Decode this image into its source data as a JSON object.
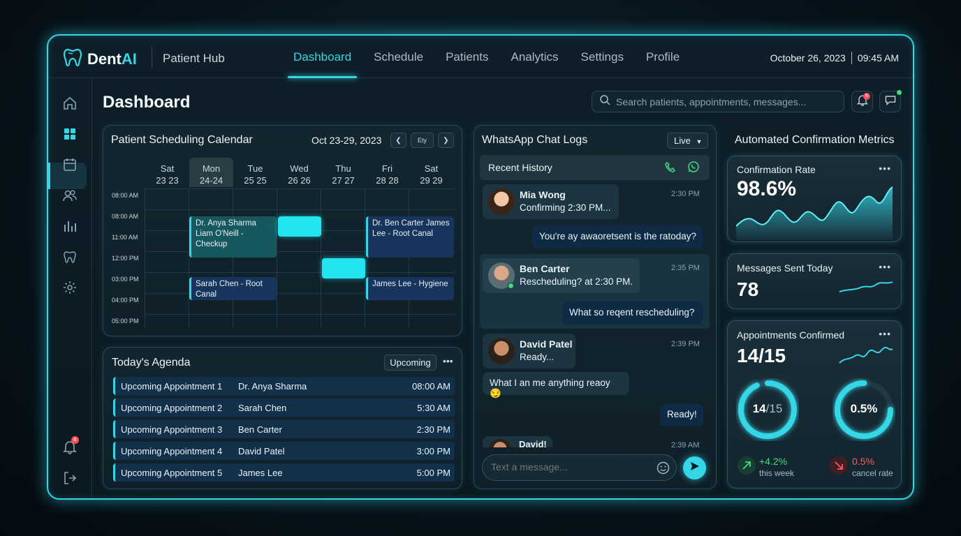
{
  "app": {
    "brand_prefix": "Dent",
    "brand_suffix": "AI",
    "section": "Patient Hub"
  },
  "nav": {
    "tabs": [
      {
        "label": "Dashboard",
        "active": true
      },
      {
        "label": "Schedule"
      },
      {
        "label": "Patients"
      },
      {
        "label": "Analytics"
      },
      {
        "label": "Settings"
      },
      {
        "label": "Profile"
      }
    ]
  },
  "header": {
    "date": "October 26, 2023",
    "time": "09:45 AM"
  },
  "sidebar": {
    "icons": [
      "home-icon",
      "dashboard-icon",
      "calendar-icon",
      "users-icon",
      "chart-icon",
      "tooth-icon",
      "gear-icon",
      "bell-icon",
      "logout-icon"
    ],
    "bell_badge": "6"
  },
  "main": {
    "title": "Dashboard",
    "search_placeholder": "Search patients, appointments, messages...",
    "notif_badge": "6"
  },
  "calendar": {
    "title": "Patient Scheduling Calendar",
    "range": "Oct 23-29, 2023",
    "nav_btn": "Ety",
    "days": [
      {
        "name": "Sat",
        "date": "23 23"
      },
      {
        "name": "Mon",
        "date": "24-24"
      },
      {
        "name": "Tue",
        "date": "25 25"
      },
      {
        "name": "Wed",
        "date": "26 26"
      },
      {
        "name": "Thu",
        "date": "27 27"
      },
      {
        "name": "Fri",
        "date": "28 28"
      },
      {
        "name": "Sat",
        "date": "29 29"
      }
    ],
    "times": [
      "08:00 AM",
      "08:00 AM",
      "11:00 AM",
      "12:00 PM",
      "03:00 PM",
      "04:00 PM",
      "05:00 PM"
    ],
    "events": [
      {
        "text": "Dr. Anya Sharma Liam O'Neill - Checkup"
      },
      {
        "text": "Dr. Ben Carter James Lee - Root Canal"
      },
      {
        "text": "Sarah Chen - Root Canal"
      },
      {
        "text": "James Lee - Hygiene"
      }
    ]
  },
  "agenda": {
    "title": "Today's Agenda",
    "filter": "Upcoming",
    "rows": [
      {
        "label": "Upcoming Appointment 1",
        "doctor": "Dr. Anya Sharma",
        "time": "08:00 AM"
      },
      {
        "label": "Upcoming Appointment 2",
        "doctor": "Sarah Chen",
        "time": "5:30 AM"
      },
      {
        "label": "Upcoming Appointment 3",
        "doctor": "Ben Carter",
        "time": "2:30 PM"
      },
      {
        "label": "Upcoming Appointment 4",
        "doctor": "David Patel",
        "time": "3:00 PM"
      },
      {
        "label": "Upcoming Appointment 5",
        "doctor": "James Lee",
        "time": "5:00 PM"
      }
    ]
  },
  "chat": {
    "title": "WhatsApp Chat Logs",
    "mode": "Live",
    "history_label": "Recent History",
    "messages": [
      {
        "name": "Mia Wong",
        "text": "Confirming 2:30 PM...",
        "time": "2:30 PM"
      },
      {
        "reply": "You're ay awaoretsent is the ratoday?"
      },
      {
        "name": "Ben Carter",
        "text": "Rescheduling? at 2:30 PM.",
        "time": "2:35 PM"
      },
      {
        "reply": "What so reqent rescheduling?"
      },
      {
        "name": "David Patel",
        "text": "Ready...",
        "time": "2:39 PM"
      },
      {
        "incoming": "What I an me anything reaoy 😏"
      },
      {
        "reply": "Ready!"
      },
      {
        "name": "David!",
        "time": "2:39 AM"
      }
    ],
    "input_placeholder": "Text a message..."
  },
  "metrics": {
    "title": "Automated Confirmation Metrics",
    "confirmation_rate": {
      "label": "Confirmation Rate",
      "value": "98.6%"
    },
    "messages_sent": {
      "label": "Messages Sent Today",
      "value": "78"
    },
    "appointments": {
      "label": "Appointments Confirmed",
      "value": "14/15",
      "ring1_value": "14",
      "ring1_total": "/15",
      "ring1_fraction": 0.933,
      "ring2_value": "0.5%",
      "ring2_fraction": 0.75
    },
    "trend_up": {
      "value": "+4.2%",
      "label": "this week"
    },
    "trend_down": {
      "value": "0.5%",
      "label": "cancel rate"
    }
  },
  "colors": {
    "accent": "#35d6e6",
    "positive": "#3ddc84",
    "negative": "#ff5a5f"
  }
}
